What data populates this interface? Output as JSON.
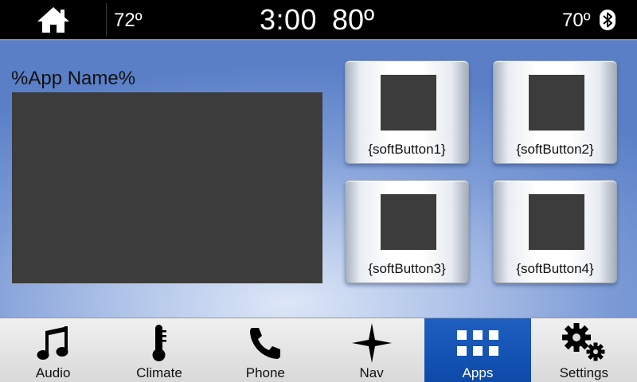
{
  "status_bar": {
    "left_temp": "72º",
    "time": "3:00",
    "outside_temp": "80º",
    "right_temp": "70º",
    "icons": [
      "home-icon",
      "bluetooth-icon"
    ]
  },
  "main": {
    "app_name": "%App Name%",
    "soft_buttons": [
      {
        "label": "{softButton1}"
      },
      {
        "label": "{softButton2}"
      },
      {
        "label": "{softButton3}"
      },
      {
        "label": "{softButton4}"
      }
    ]
  },
  "nav": {
    "active": "Apps",
    "items": [
      {
        "label": "Audio",
        "icon": "music-note-icon"
      },
      {
        "label": "Climate",
        "icon": "thermometer-icon"
      },
      {
        "label": "Phone",
        "icon": "phone-icon"
      },
      {
        "label": "Nav",
        "icon": "compass-star-icon"
      },
      {
        "label": "Apps",
        "icon": "apps-grid-icon"
      },
      {
        "label": "Settings",
        "icon": "gears-icon"
      }
    ]
  },
  "colors": {
    "status_bar_bg": "#000000",
    "main_bg_center": "#dde7f7",
    "main_bg_edge": "#5a7fc7",
    "placeholder_fill": "#3c3c3c",
    "nav_active_bg": "#0d4aa8",
    "nav_bg": "#dcdcdc"
  }
}
